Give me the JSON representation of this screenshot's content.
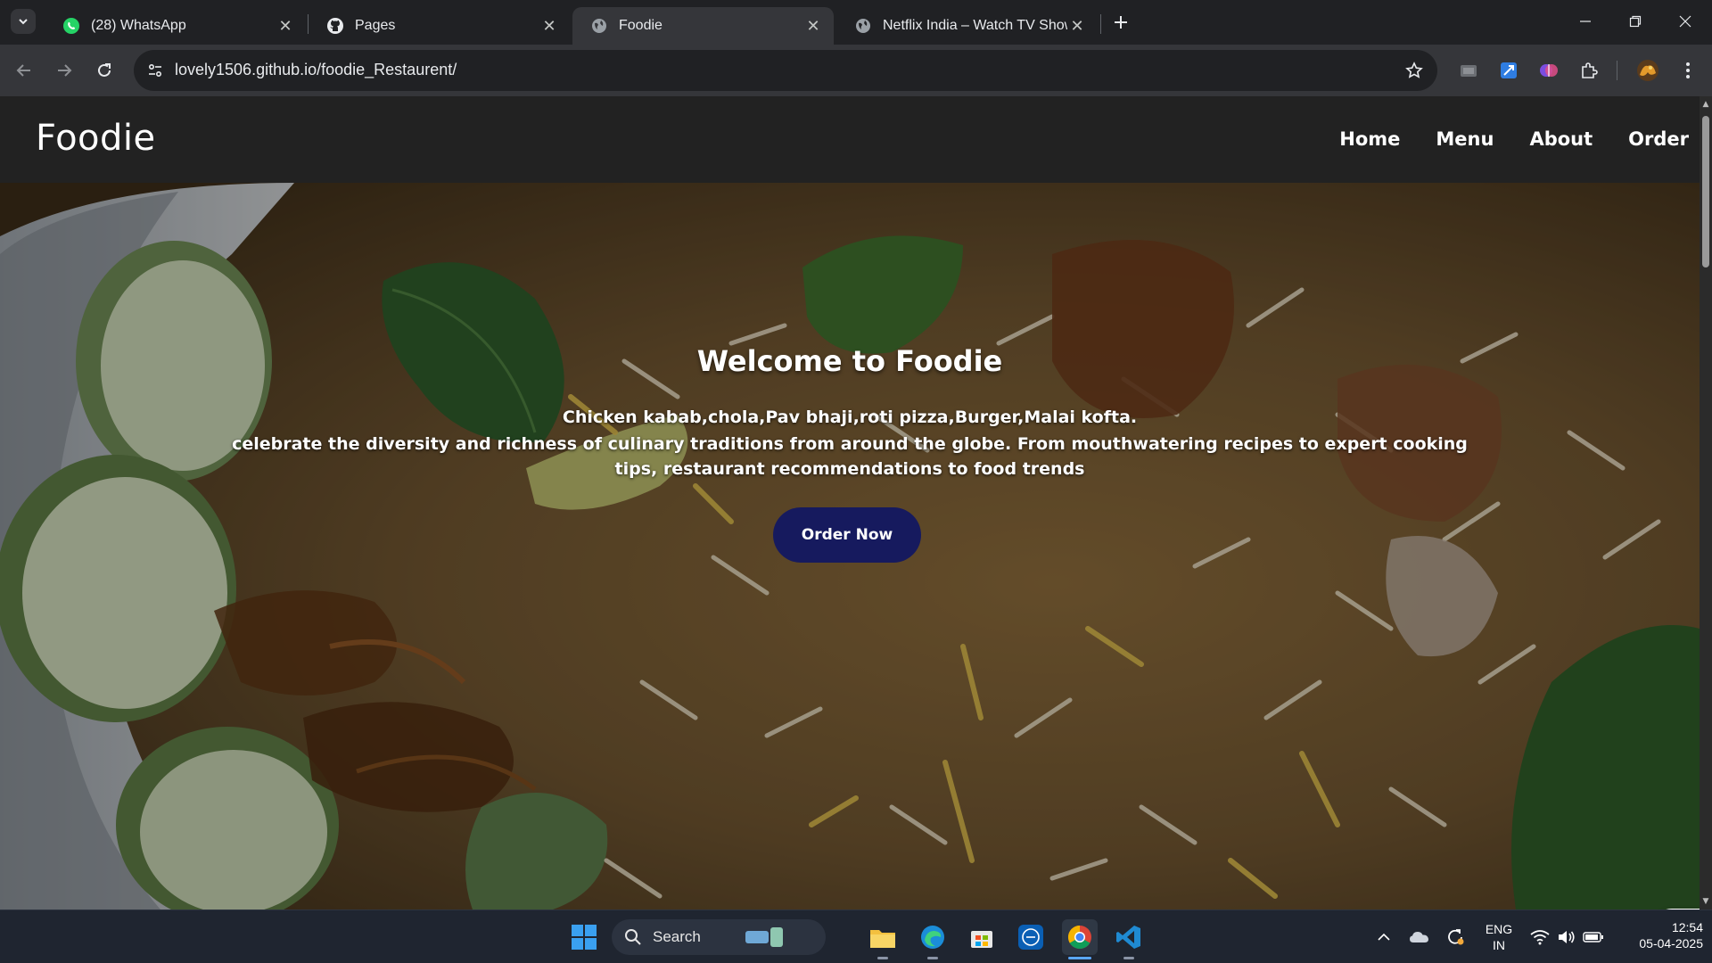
{
  "browser": {
    "tabs": [
      {
        "title": "(28) WhatsApp",
        "active": false,
        "icon": "whatsapp-icon"
      },
      {
        "title": "Pages",
        "active": false,
        "icon": "github-icon"
      },
      {
        "title": "Foodie",
        "active": true,
        "icon": "globe-icon"
      },
      {
        "title": "Netflix India – Watch TV Shows",
        "active": false,
        "icon": "globe-icon"
      }
    ],
    "url": "lovely1506.github.io/foodie_Restaurent/"
  },
  "site": {
    "logo": "Foodie",
    "nav": [
      "Home",
      "Menu",
      "About",
      "Order"
    ],
    "hero": {
      "title": "Welcome to Foodie",
      "line1": "Chicken kabab,chola,Pav bhaji,roti pizza,Burger,Malai kofta.",
      "line2": "celebrate the diversity and richness of culinary traditions from around the globe. From mouthwatering recipes to expert cooking tips, restaurant recommendations to food trends",
      "cta": "Order Now"
    }
  },
  "taskbar": {
    "search_label": "Search",
    "lang_top": "ENG",
    "lang_bottom": "IN",
    "time": "12:54",
    "date": "05-04-2025"
  },
  "colors": {
    "nav_bg": "#222222",
    "cta_bg": "#161a5e",
    "browser_frame": "#202124",
    "browser_toolbar": "#35363a"
  }
}
